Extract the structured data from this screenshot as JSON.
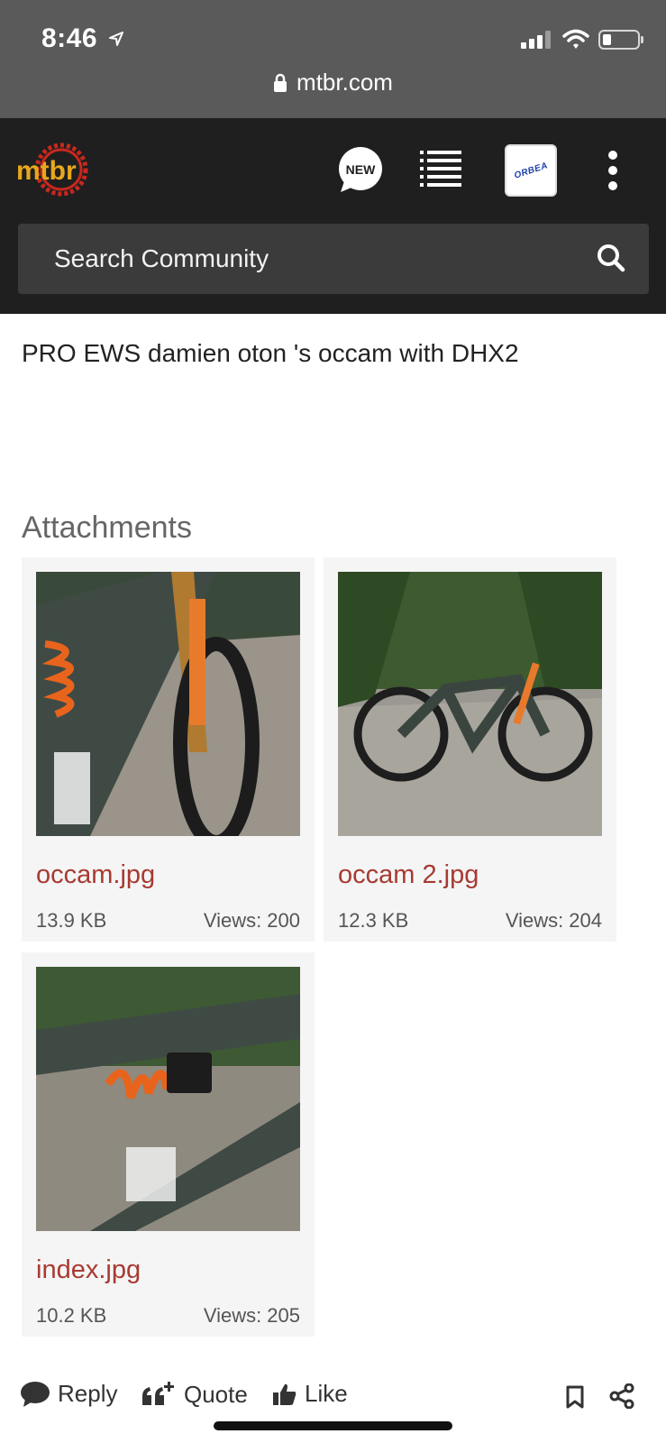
{
  "status_bar": {
    "time": "8:46",
    "url": "mtbr.com"
  },
  "header": {
    "logo_text": "mtbr",
    "new_badge": "NEW",
    "sponsor_logo": "ORBEA",
    "search_placeholder": "Search Community"
  },
  "post": {
    "text": "PRO EWS damien oton 's occam with DHX2"
  },
  "attachments": {
    "title": "Attachments",
    "items": [
      {
        "name": "occam.jpg",
        "size": "13.9 KB",
        "views_label": "Views:",
        "views": "200"
      },
      {
        "name": "occam 2.jpg",
        "size": "12.3 KB",
        "views_label": "Views:",
        "views": "204"
      },
      {
        "name": "index.jpg",
        "size": "10.2 KB",
        "views_label": "Views:",
        "views": "205"
      }
    ]
  },
  "actions": {
    "reply": "Reply",
    "quote": "Quote",
    "like": "Like"
  },
  "colors": {
    "header_bg": "#1f1f1f",
    "status_bg": "#5a5a5a",
    "link": "#a83a32",
    "logo": "#e8a81c"
  },
  "icons": [
    "location-arrow-icon",
    "signal-icon",
    "wifi-icon",
    "battery-icon",
    "lock-icon",
    "new-icon",
    "list-icon",
    "more-icon",
    "search-icon",
    "reply-icon",
    "quote-icon",
    "like-icon",
    "bookmark-icon",
    "share-icon"
  ]
}
